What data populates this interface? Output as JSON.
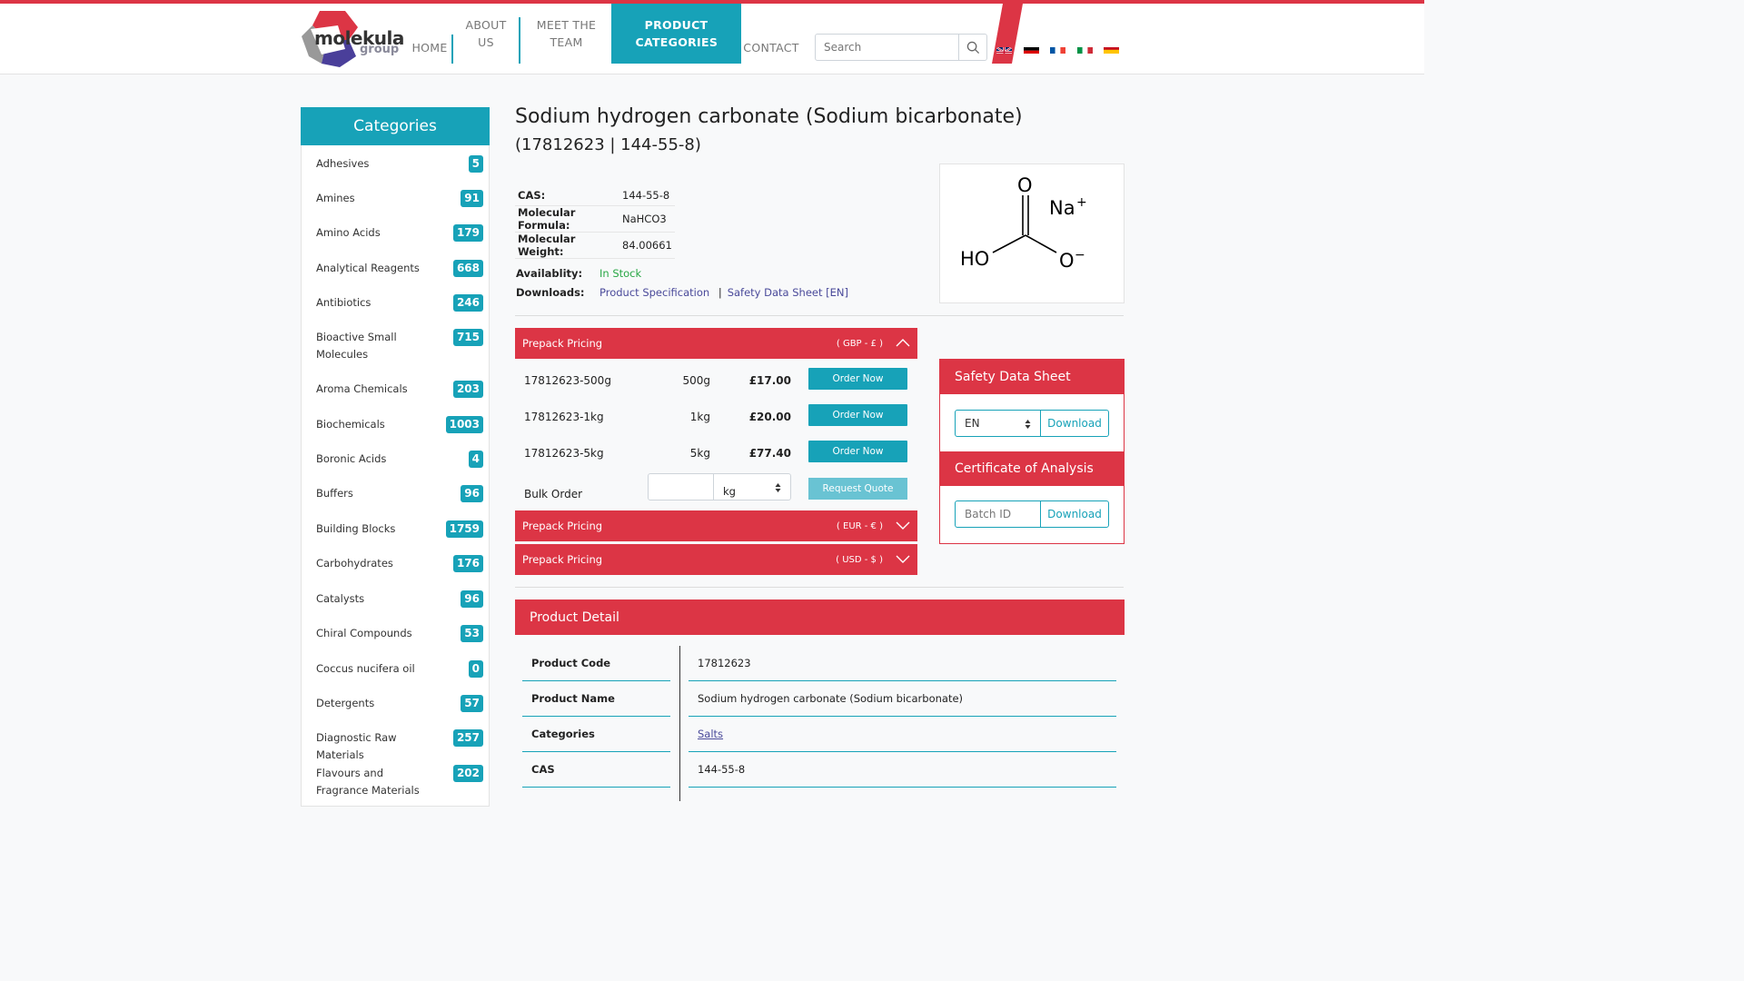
{
  "brand": {
    "name": "molekula",
    "sub": "group"
  },
  "nav": [
    {
      "label": "HOME"
    },
    {
      "label": "ABOUT US"
    },
    {
      "label": "MEET THE TEAM"
    },
    {
      "label": "PRODUCT CATEGORIES"
    },
    {
      "label": "CONTACT"
    }
  ],
  "search": {
    "placeholder": "Search",
    "icon": "search-icon"
  },
  "languages": [
    "gb-flag-icon",
    "de-flag-icon",
    "fr-flag-icon",
    "it-flag-icon",
    "es-flag-icon"
  ],
  "sidebar": {
    "title": "Categories",
    "items": [
      {
        "label": "Adhesives",
        "count": "5"
      },
      {
        "label": "Amines",
        "count": "91"
      },
      {
        "label": "Amino Acids",
        "count": "179"
      },
      {
        "label": "Analytical Reagents",
        "count": "668"
      },
      {
        "label": "Antibiotics",
        "count": "246"
      },
      {
        "label": "Bioactive Small Molecules",
        "count": "715"
      },
      {
        "label": "Aroma Chemicals",
        "count": "203"
      },
      {
        "label": "Biochemicals",
        "count": "1003"
      },
      {
        "label": "Boronic Acids",
        "count": "4"
      },
      {
        "label": "Buffers",
        "count": "96"
      },
      {
        "label": "Building Blocks",
        "count": "1759"
      },
      {
        "label": "Carbohydrates",
        "count": "176"
      },
      {
        "label": "Catalysts",
        "count": "96"
      },
      {
        "label": "Chiral Compounds",
        "count": "53"
      },
      {
        "label": "Coccus nucifera oil",
        "count": "0"
      },
      {
        "label": "Detergents",
        "count": "57"
      },
      {
        "label": "Diagnostic Raw Materials",
        "count": "257"
      },
      {
        "label": "Flavours and Fragrance Materials",
        "count": "202"
      }
    ]
  },
  "product": {
    "title": "Sodium hydrogen carbonate (Sodium bicarbonate)",
    "subtitle": "(17812623 | 144-55-8)",
    "props": [
      {
        "k": "CAS:",
        "v": "144-55-8"
      },
      {
        "k": "Molecular Formula:",
        "v": "NaHCO3"
      },
      {
        "k": "Molecular Weight:",
        "v": "84.00661"
      }
    ],
    "availability_label": "Availablity:",
    "availability": "In Stock",
    "downloads_label": "Downloads:",
    "download_spec": "Product Specification",
    "download_sep": "|",
    "download_sds": "Safety Data Sheet [EN]",
    "structure": {
      "o_top": "O",
      "na": "Na",
      "na_charge": "+",
      "ho": "HO",
      "o_minus": "O",
      "o_charge": "−"
    }
  },
  "pricing": {
    "gbp": {
      "label": "Prepack Pricing",
      "currency": "( GBP - £ )"
    },
    "eur": {
      "label": "Prepack Pricing",
      "currency": "( EUR - € )"
    },
    "usd": {
      "label": "Prepack Pricing",
      "currency": "( USD - $ )"
    },
    "rows": [
      {
        "code": "17812623-500g",
        "size": "500g",
        "price": "£17.00",
        "button": "Order Now"
      },
      {
        "code": "17812623-1kg",
        "size": "1kg",
        "price": "£20.00",
        "button": "Order Now"
      },
      {
        "code": "17812623-5kg",
        "size": "5kg",
        "price": "£77.40",
        "button": "Order Now"
      }
    ],
    "bulk": {
      "label": "Bulk Order",
      "value": "",
      "unit": "kg",
      "button": "Request Quote"
    }
  },
  "sds": {
    "title": "Safety Data Sheet",
    "language": "EN",
    "button": "Download"
  },
  "coa": {
    "title": "Certificate of Analysis",
    "placeholder": "Batch ID",
    "button": "Download"
  },
  "detail": {
    "title": "Product Detail",
    "rows": [
      {
        "k": "Product Code",
        "v": "17812623"
      },
      {
        "k": "Product Name",
        "v": "Sodium hydrogen carbonate (Sodium bicarbonate)"
      },
      {
        "k": "Categories",
        "v": "Salts"
      },
      {
        "k": "CAS",
        "v": "144-55-8"
      }
    ]
  },
  "colors": {
    "teal": "#17a2b8",
    "red": "#dc3545",
    "green": "#28a745"
  }
}
